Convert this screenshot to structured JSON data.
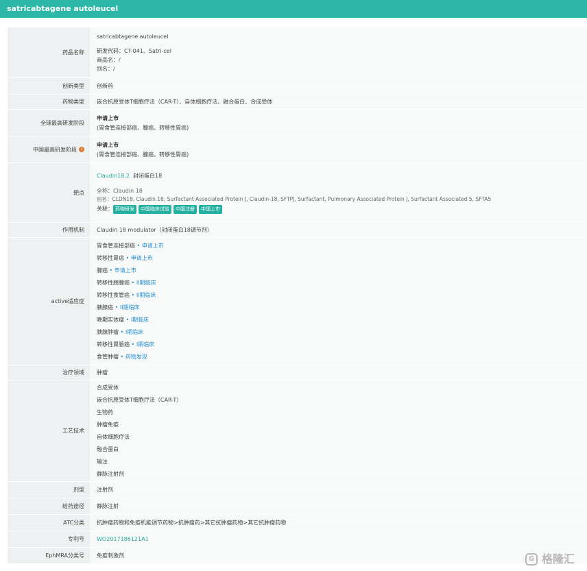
{
  "title": "satricabtagene autoleucel",
  "rows": {
    "name": {
      "label": "药品名称",
      "v1": "satricabtagene autoleucel",
      "v2": "研发代码：CT-041、Satri-cel",
      "v3": "商品名：/",
      "v4": "别名：/"
    },
    "innovation": {
      "label": "创新类型",
      "value": "创新药"
    },
    "drug_type": {
      "label": "药物类型",
      "value": "嵌合抗原受体T细胞疗法（CAR-T）、自体细胞疗法、融合蛋白、合成受体"
    },
    "global_stage": {
      "label": "全球最高研发阶段",
      "stage": "申请上市",
      "detail": "(胃食管连接部癌、腺癌、转移性胃癌)"
    },
    "china_stage": {
      "label": "中国最高研发阶段",
      "stage": "申请上市",
      "detail": "(胃食管连接部癌、腺癌、转移性胃癌)"
    },
    "target": {
      "label": "靶点",
      "link": "Claudin18.2",
      "alias_cn": "封闭蛋白18",
      "fullname": "全称：Claudin 18",
      "aliases": "别名：CLDN18, Claudin 18, Surfactant Associated Protein J, Claudin-18, SFTPJ, Surfactant, Pulmonary Associated Protein J, Surfactant Associated 5, SFTA5",
      "related_label": "关联：",
      "badges": [
        "药物研发",
        "中国临床试验",
        "中国注册",
        "中国上市"
      ]
    },
    "mechanism": {
      "label": "作用机制",
      "value": "Claudin 18 modulator（封闭蛋白18调节剂）"
    },
    "indications": {
      "label": "active适应症",
      "items": [
        {
          "name": "胃食管连接部癌",
          "stage": "申请上市"
        },
        {
          "name": "转移性胃癌",
          "stage": "申请上市"
        },
        {
          "name": "腺癌",
          "stage": "申请上市"
        },
        {
          "name": "转移性胰腺癌",
          "stage": "II期临床"
        },
        {
          "name": "转移性食管癌",
          "stage": "II期临床"
        },
        {
          "name": "胰腺癌",
          "stage": "II期临床"
        },
        {
          "name": "晚期实体瘤",
          "stage": "I期临床"
        },
        {
          "name": "胰腺肿瘤",
          "stage": "I期临床"
        },
        {
          "name": "转移性胃肠癌",
          "stage": "I期临床"
        },
        {
          "name": "食管肿瘤",
          "stage": "药物发现"
        }
      ],
      "sep": "•"
    },
    "therapy_area": {
      "label": "治疗领域",
      "value": "肿瘤"
    },
    "technology": {
      "label": "工艺技术",
      "items": [
        "合成受体",
        "嵌合抗原受体T细胞疗法（CAR-T）",
        "生物药",
        "肿瘤免疫",
        "自体细胞疗法",
        "融合蛋白",
        "输注",
        "静脉注射剂"
      ]
    },
    "dosage_form": {
      "label": "剂型",
      "value": "注射剂"
    },
    "route": {
      "label": "给药途径",
      "value": "静脉注射"
    },
    "atc": {
      "label": "ATC分类",
      "value": "抗肿瘤药物和免疫机能调节药物>抗肿瘤药>其它抗肿瘤药物>其它抗肿瘤药物"
    },
    "patent": {
      "label": "专利号",
      "value": "WO2017186121A1"
    },
    "ephmra": {
      "label": "EphMRA分类号",
      "value": "免疫刺激剂"
    }
  },
  "watermark": {
    "text": "格隆汇",
    "icon": "gelonghui-logo-icon"
  }
}
